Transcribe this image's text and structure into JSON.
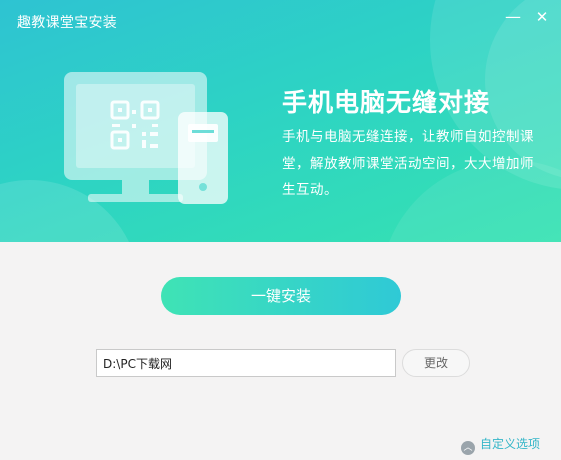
{
  "window": {
    "title": "趣教课堂宝安装",
    "minimize_icon": "—",
    "close_icon": "✕"
  },
  "banner": {
    "headline": "手机电脑无缝对接",
    "description": "手机与电脑无缝连接，让教师自如控制课堂，解放教师课堂活动空间，大大增加师生互动。",
    "illustration": "computer-phone-qr-icon"
  },
  "install": {
    "button_label": "一键安装"
  },
  "path": {
    "value": "D:\\PC下载网",
    "change_label": "更改"
  },
  "options": {
    "custom_label": "自定义选项",
    "chevron_icon": "︿"
  },
  "colors": {
    "accent_start": "#3fe3b5",
    "accent_end": "#2fc9d6",
    "link": "#34b6c8"
  }
}
